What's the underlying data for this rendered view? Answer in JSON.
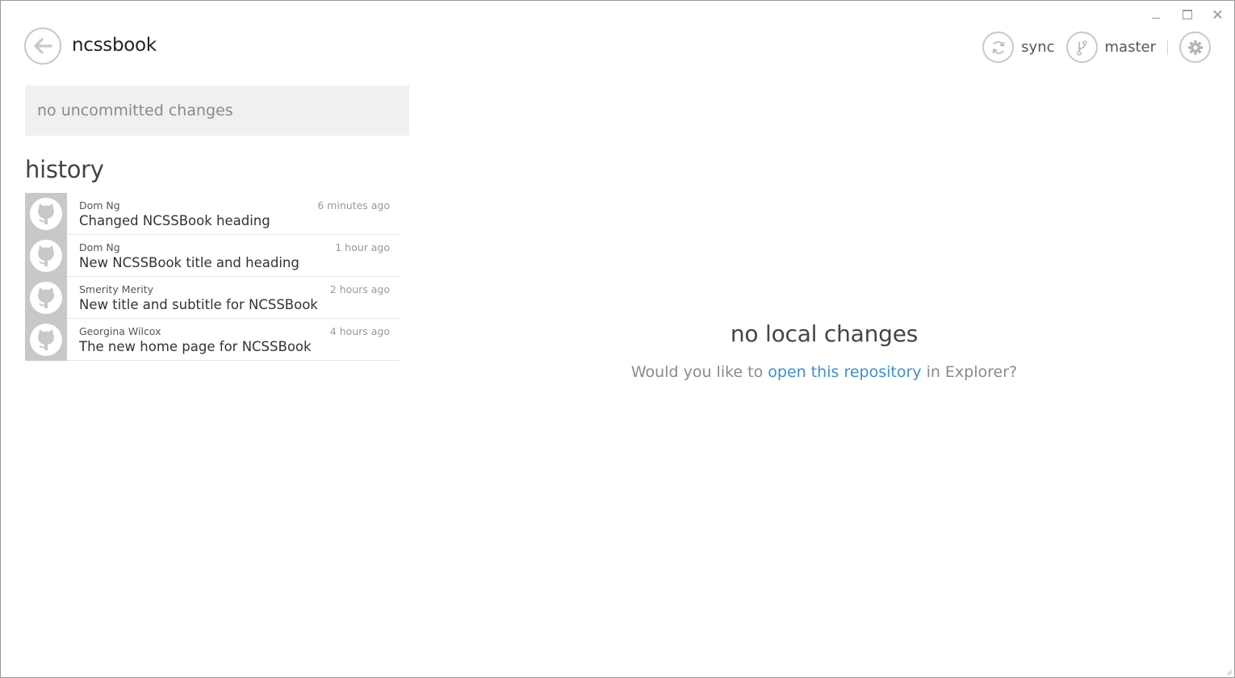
{
  "window": {
    "controls": [
      "minimize",
      "maximize",
      "close"
    ]
  },
  "header": {
    "repo_name": "ncssbook",
    "sync_label": "sync",
    "branch_label": "master"
  },
  "uncommitted": {
    "text": "no uncommitted changes"
  },
  "history": {
    "title": "history",
    "commits": [
      {
        "author": "Dom Ng",
        "time": "6 minutes ago",
        "message": "Changed NCSSBook heading"
      },
      {
        "author": "Dom Ng",
        "time": "1 hour ago",
        "message": "New NCSSBook title and heading"
      },
      {
        "author": "Smerity Merity",
        "time": "2 hours ago",
        "message": "New title and subtitle for NCSSBook"
      },
      {
        "author": "Georgina Wilcox",
        "time": "4 hours ago",
        "message": "The new home page for NCSSBook"
      }
    ]
  },
  "empty_state": {
    "title": "no local changes",
    "prefix": "Would you like to ",
    "link": "open this repository",
    "suffix": " in Explorer?"
  },
  "icons": {
    "back": "back-arrow-icon",
    "sync": "sync-icon",
    "branch": "branch-icon",
    "settings": "gear-icon",
    "avatar": "octocat-icon"
  },
  "colors": {
    "accent_link": "#3f8fd0",
    "avatar_bg": "#c8c8c8",
    "panel_bg": "#f0f0f0"
  }
}
